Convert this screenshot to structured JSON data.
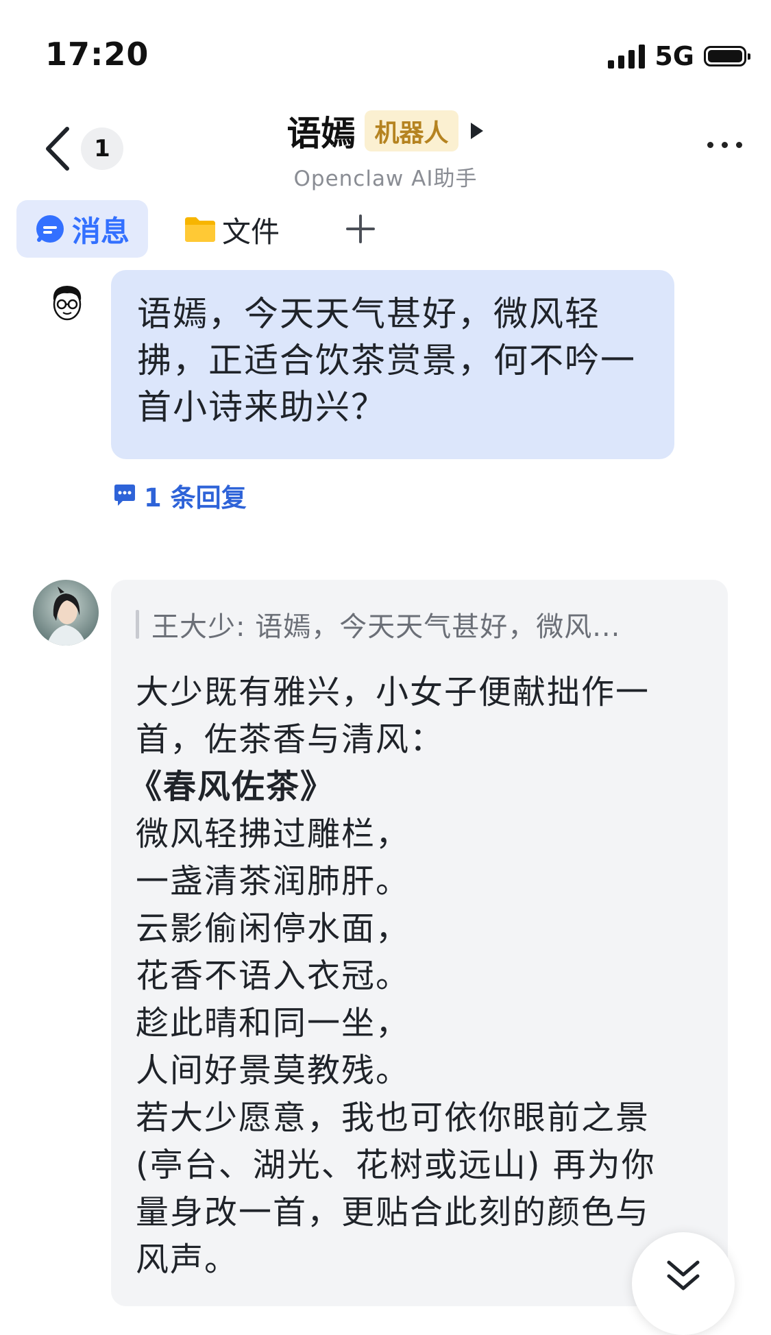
{
  "status_bar": {
    "time": "17:20",
    "network": "5G"
  },
  "header": {
    "back_count": "1",
    "title": "语嫣",
    "badge": "机器人",
    "subtitle": "Openclaw AI助手"
  },
  "tabs": [
    {
      "label": "消息",
      "icon": "message-icon",
      "active": true
    },
    {
      "label": "文件",
      "icon": "folder-icon",
      "active": false
    }
  ],
  "user_message": {
    "lines": [
      "语嫣，今天天气甚好，微风轻",
      "拂，正适合饮茶赏景，何不吟一",
      "首小诗来助兴？"
    ],
    "reply_count_label": "1 条回复"
  },
  "bot_message": {
    "quote": "王大少: 语嫣，今天天气甚好，微风...",
    "lines": [
      "大少既有雅兴，小女子便献拙作一",
      "首，佐茶香与清风：",
      "《春风佐茶》",
      "微风轻拂过雕栏，",
      "一盏清茶润肺肝。",
      "云影偷闲停水面，",
      "花香不语入衣冠。",
      "趁此晴和同一坐，",
      "人间好景莫教残。",
      "若大少愿意，我也可依你眼前之景",
      "(亭台、湖光、花树或远山) 再为你",
      "量身改一首，更贴合此刻的颜色与",
      "风声。"
    ]
  },
  "colors": {
    "accent": "#3370ff",
    "user_bubble": "#dce6fb",
    "bot_bubble": "#f3f4f6",
    "badge_bg": "#fbf0d1",
    "badge_text": "#b58320"
  }
}
